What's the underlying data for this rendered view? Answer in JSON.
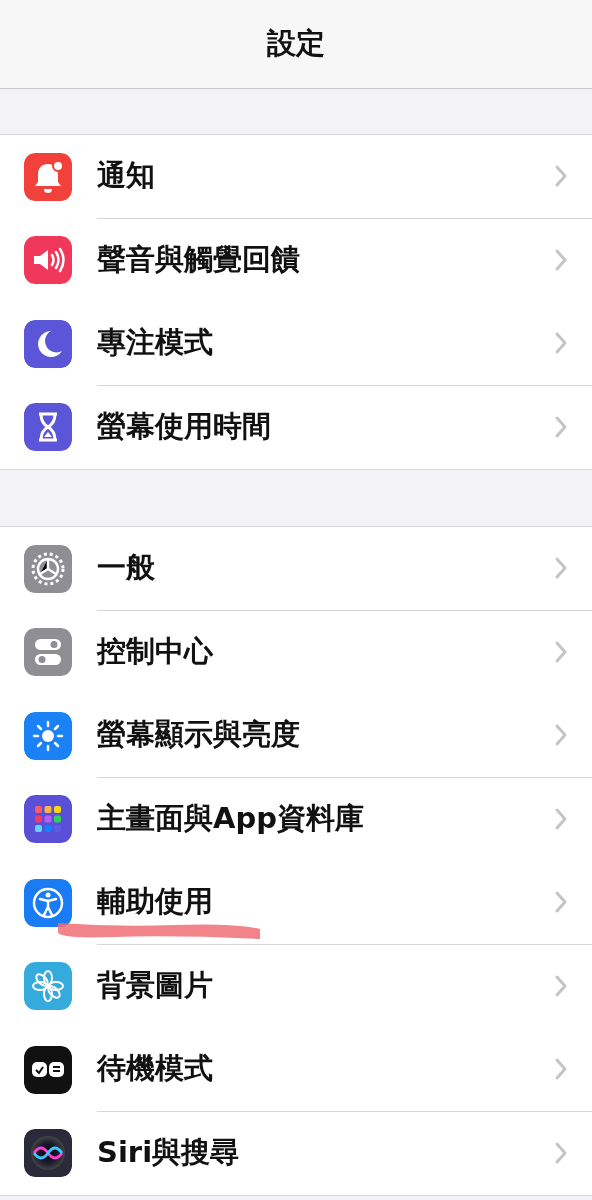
{
  "navigation_bar": {
    "title": "設定"
  },
  "groups": [
    {
      "items": [
        {
          "label": "通知",
          "color": "#f2403a",
          "underlined": false
        },
        {
          "label": "聲音與觸覺回饋",
          "color": "#f0385a",
          "underlined": false
        },
        {
          "label": "專注模式",
          "color": "#5b56d8",
          "underlined": false
        },
        {
          "label": "螢幕使用時間",
          "color": "#5b56d8",
          "underlined": false
        }
      ]
    },
    {
      "items": [
        {
          "label": "一般",
          "color": "#8e8e93",
          "underlined": false
        },
        {
          "label": "控制中心",
          "color": "#8e8e93",
          "underlined": false
        },
        {
          "label": "螢幕顯示與亮度",
          "color": "#1a82f5",
          "underlined": false
        },
        {
          "label": "主畫面與App資料庫",
          "color": "#5a50d8",
          "underlined": false
        },
        {
          "label": "輔助使用",
          "color": "#1a7cf5",
          "underlined": true
        },
        {
          "label": "背景圖片",
          "color": "#35aadc",
          "underlined": false
        },
        {
          "label": "待機模式",
          "color": "#111111",
          "underlined": false
        },
        {
          "label": "Siri與搜尋",
          "color": "#2a2a3a",
          "underlined": false
        }
      ]
    }
  ]
}
